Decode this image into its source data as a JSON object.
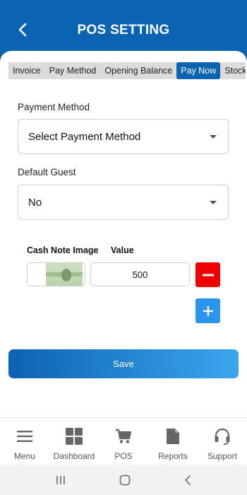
{
  "header": {
    "title": "POS SETTING"
  },
  "tabs": [
    {
      "label": "Invoice",
      "active": false
    },
    {
      "label": "Pay Method",
      "active": false
    },
    {
      "label": "Opening Balance",
      "active": false
    },
    {
      "label": "Pay Now",
      "active": true
    },
    {
      "label": "Stock In",
      "active": false
    }
  ],
  "form": {
    "payment_method": {
      "label": "Payment Method",
      "value": "Select Payment Method"
    },
    "default_guest": {
      "label": "Default Guest",
      "value": "No"
    }
  },
  "cash_notes": {
    "headers": {
      "image": "Cash Note Image",
      "value": "Value"
    },
    "rows": [
      {
        "value": "500",
        "image_icon": "currency-note-image"
      }
    ]
  },
  "actions": {
    "save_label": "Save"
  },
  "bottom_nav": [
    {
      "label": "Menu",
      "icon": "menu-icon"
    },
    {
      "label": "Dashboard",
      "icon": "dashboard-icon"
    },
    {
      "label": "POS",
      "icon": "cart-icon"
    },
    {
      "label": "Reports",
      "icon": "document-icon"
    },
    {
      "label": "Support",
      "icon": "headset-icon"
    }
  ],
  "colors": {
    "primary": "#0b64b1",
    "tab_bar": "#dcdcdc",
    "danger": "#f00000",
    "add": "#2a95ea"
  }
}
